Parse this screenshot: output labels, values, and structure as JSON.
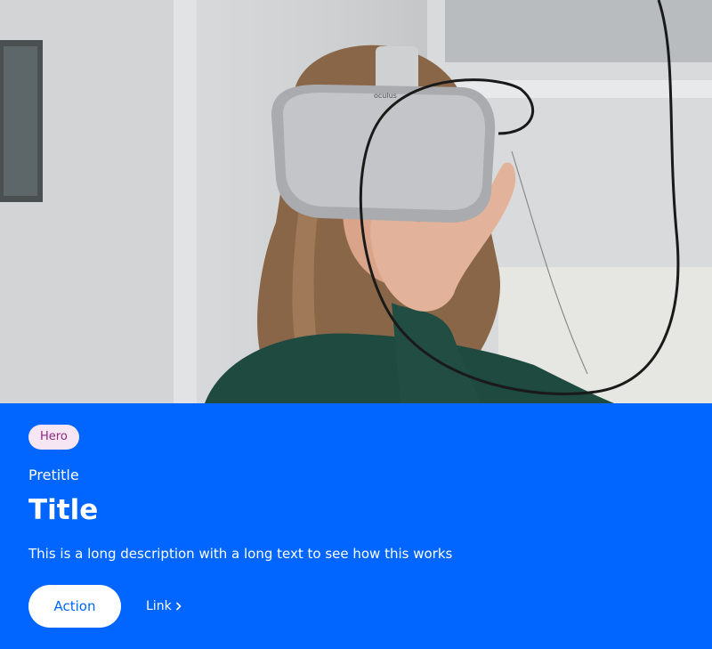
{
  "hero": {
    "image_alt": "Person wearing oculus VR headset",
    "headset_brand": "oculus",
    "tag": "Hero",
    "pretitle": "Pretitle",
    "title": "Title",
    "description": "This is a long description with a long text to see how this works",
    "action_label": "Action",
    "link_label": "Link",
    "link_icon": "chevron-right-icon"
  },
  "colors": {
    "background": "#0066ff",
    "tag_bg": "#f6e6f4",
    "tag_text": "#8a2a7a",
    "button_bg": "#ffffff",
    "button_text": "#0066ff"
  }
}
